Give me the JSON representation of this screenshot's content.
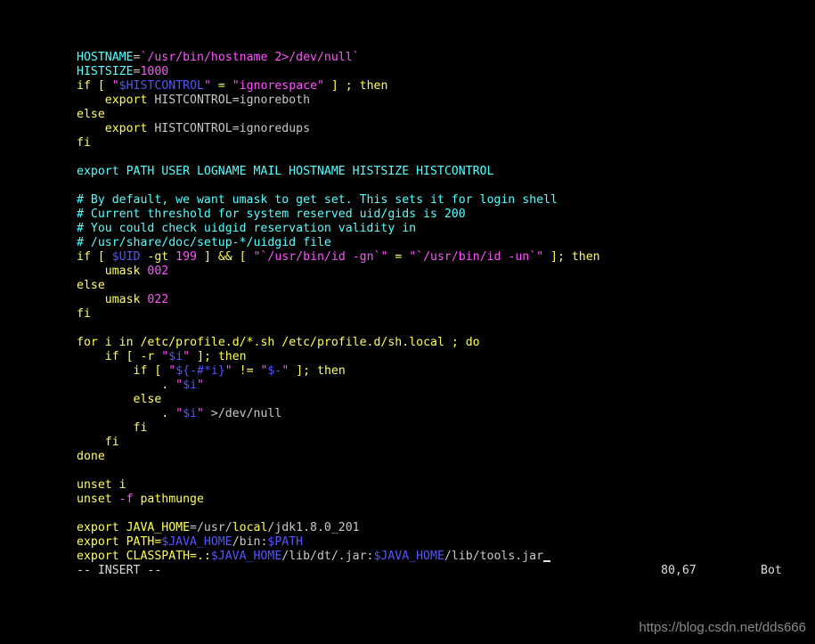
{
  "colors": {
    "background": "#000000",
    "keyword": "#ffff55",
    "identifier": "#55ffff",
    "string": "#ff55ff",
    "number": "#ff55ff",
    "variable": "#5555ff",
    "plain": "#c8c8c8",
    "status": "#dcdcdc"
  },
  "editor": {
    "lines": [
      [
        {
          "t": "HOSTNAME",
          "c": "identifier"
        },
        {
          "t": "=",
          "c": "plain"
        },
        {
          "t": "`/usr/bin/hostname 2>/dev/null`",
          "c": "string"
        }
      ],
      [
        {
          "t": "HISTSIZE",
          "c": "identifier"
        },
        {
          "t": "=",
          "c": "plain"
        },
        {
          "t": "1000",
          "c": "number"
        }
      ],
      [
        {
          "t": "if",
          "c": "keyword"
        },
        {
          "t": " [ ",
          "c": "keyword"
        },
        {
          "t": "\"",
          "c": "string"
        },
        {
          "t": "$HISTCONTROL",
          "c": "variable"
        },
        {
          "t": "\"",
          "c": "string"
        },
        {
          "t": " = ",
          "c": "keyword"
        },
        {
          "t": "\"ignorespace\"",
          "c": "string"
        },
        {
          "t": " ] ; ",
          "c": "keyword"
        },
        {
          "t": "then",
          "c": "keyword"
        }
      ],
      [
        {
          "t": "    ",
          "c": "plain"
        },
        {
          "t": "export",
          "c": "keyword"
        },
        {
          "t": " HISTCONTROL",
          "c": "plain"
        },
        {
          "t": "=",
          "c": "plain"
        },
        {
          "t": "ignoreboth",
          "c": "plain"
        }
      ],
      [
        {
          "t": "else",
          "c": "keyword"
        }
      ],
      [
        {
          "t": "    ",
          "c": "plain"
        },
        {
          "t": "export",
          "c": "keyword"
        },
        {
          "t": " HISTCONTROL",
          "c": "plain"
        },
        {
          "t": "=",
          "c": "plain"
        },
        {
          "t": "ignoredups",
          "c": "plain"
        }
      ],
      [
        {
          "t": "fi",
          "c": "keyword"
        }
      ],
      [],
      [
        {
          "t": "export PATH USER LOGNAME MAIL HOSTNAME HISTSIZE HISTCONTROL",
          "c": "identifier"
        }
      ],
      [],
      [
        {
          "t": "# By default, we want umask to get set. This sets it for login shell",
          "c": "identifier"
        }
      ],
      [
        {
          "t": "# Current threshold for system reserved uid/gids is 200",
          "c": "identifier"
        }
      ],
      [
        {
          "t": "# You could check uidgid reservation validity in",
          "c": "identifier"
        }
      ],
      [
        {
          "t": "# /usr/share/doc/setup-*/uidgid file",
          "c": "identifier"
        }
      ],
      [
        {
          "t": "if [ ",
          "c": "keyword"
        },
        {
          "t": "$UID",
          "c": "variable"
        },
        {
          "t": " -gt ",
          "c": "keyword"
        },
        {
          "t": "199",
          "c": "number"
        },
        {
          "t": " ] && [ ",
          "c": "keyword"
        },
        {
          "t": "\"`",
          "c": "string"
        },
        {
          "t": "/usr/bin/id -gn",
          "c": "string"
        },
        {
          "t": "`\"",
          "c": "string"
        },
        {
          "t": " = ",
          "c": "keyword"
        },
        {
          "t": "\"`/usr/bin/id -un`\"",
          "c": "string"
        },
        {
          "t": " ]; then",
          "c": "keyword"
        }
      ],
      [
        {
          "t": "    ",
          "c": "plain"
        },
        {
          "t": "umask",
          "c": "keyword"
        },
        {
          "t": " ",
          "c": "plain"
        },
        {
          "t": "002",
          "c": "number"
        }
      ],
      [
        {
          "t": "else",
          "c": "keyword"
        }
      ],
      [
        {
          "t": "    ",
          "c": "plain"
        },
        {
          "t": "umask",
          "c": "keyword"
        },
        {
          "t": " ",
          "c": "plain"
        },
        {
          "t": "022",
          "c": "number"
        }
      ],
      [
        {
          "t": "fi",
          "c": "keyword"
        }
      ],
      [],
      [
        {
          "t": "for",
          "c": "keyword"
        },
        {
          "t": " i ",
          "c": "keyword"
        },
        {
          "t": "in",
          "c": "keyword"
        },
        {
          "t": " /etc/profile.d/*.sh /etc/profile.d/sh.local ; ",
          "c": "keyword"
        },
        {
          "t": "do",
          "c": "keyword"
        }
      ],
      [
        {
          "t": "    ",
          "c": "plain"
        },
        {
          "t": "if [ -r ",
          "c": "keyword"
        },
        {
          "t": "\"",
          "c": "string"
        },
        {
          "t": "$i",
          "c": "variable"
        },
        {
          "t": "\"",
          "c": "string"
        },
        {
          "t": " ]; then",
          "c": "keyword"
        }
      ],
      [
        {
          "t": "        ",
          "c": "plain"
        },
        {
          "t": "if [ ",
          "c": "keyword"
        },
        {
          "t": "\"",
          "c": "string"
        },
        {
          "t": "${-#*i}",
          "c": "variable"
        },
        {
          "t": "\"",
          "c": "string"
        },
        {
          "t": " != ",
          "c": "keyword"
        },
        {
          "t": "\"",
          "c": "string"
        },
        {
          "t": "$-",
          "c": "variable"
        },
        {
          "t": "\"",
          "c": "string"
        },
        {
          "t": " ]; then",
          "c": "keyword"
        }
      ],
      [
        {
          "t": "            ",
          "c": "plain"
        },
        {
          "t": ". ",
          "c": "keyword"
        },
        {
          "t": "\"",
          "c": "string"
        },
        {
          "t": "$i",
          "c": "variable"
        },
        {
          "t": "\"",
          "c": "string"
        }
      ],
      [
        {
          "t": "        ",
          "c": "plain"
        },
        {
          "t": "else",
          "c": "keyword"
        }
      ],
      [
        {
          "t": "            ",
          "c": "plain"
        },
        {
          "t": ". ",
          "c": "keyword"
        },
        {
          "t": "\"",
          "c": "string"
        },
        {
          "t": "$i",
          "c": "variable"
        },
        {
          "t": "\"",
          "c": "string"
        },
        {
          "t": " >/dev/null",
          "c": "plain"
        }
      ],
      [
        {
          "t": "        ",
          "c": "plain"
        },
        {
          "t": "fi",
          "c": "keyword"
        }
      ],
      [
        {
          "t": "    ",
          "c": "plain"
        },
        {
          "t": "fi",
          "c": "keyword"
        }
      ],
      [
        {
          "t": "done",
          "c": "keyword"
        }
      ],
      [],
      [
        {
          "t": "unset",
          "c": "keyword"
        },
        {
          "t": " i",
          "c": "keyword"
        }
      ],
      [
        {
          "t": "unset",
          "c": "keyword"
        },
        {
          "t": " -f",
          "c": "string"
        },
        {
          "t": " pathmunge",
          "c": "keyword"
        }
      ],
      [],
      [
        {
          "t": "export",
          "c": "keyword"
        },
        {
          "t": " JAVA_HOME",
          "c": "keyword"
        },
        {
          "t": "=/usr/",
          "c": "plain"
        },
        {
          "t": "local",
          "c": "keyword"
        },
        {
          "t": "/jdk1.8.0_201",
          "c": "plain"
        }
      ],
      [
        {
          "t": "export",
          "c": "keyword"
        },
        {
          "t": " PATH=",
          "c": "keyword"
        },
        {
          "t": "$JAVA_HOME",
          "c": "variable"
        },
        {
          "t": "/bin:",
          "c": "plain"
        },
        {
          "t": "$PATH",
          "c": "variable"
        }
      ],
      [
        {
          "t": "export",
          "c": "keyword"
        },
        {
          "t": " CLASSPATH=.:",
          "c": "keyword"
        },
        {
          "t": "$JAVA_HOME",
          "c": "variable"
        },
        {
          "t": "/lib/dt/.jar:",
          "c": "plain"
        },
        {
          "t": "$JAVA_HOME",
          "c": "variable"
        },
        {
          "t": "/lib/tools.jar",
          "c": "plain"
        }
      ]
    ]
  },
  "status": {
    "mode": "-- INSERT --",
    "position": "80,67",
    "scroll": "Bot"
  },
  "watermark": "https://blog.csdn.net/dds666"
}
